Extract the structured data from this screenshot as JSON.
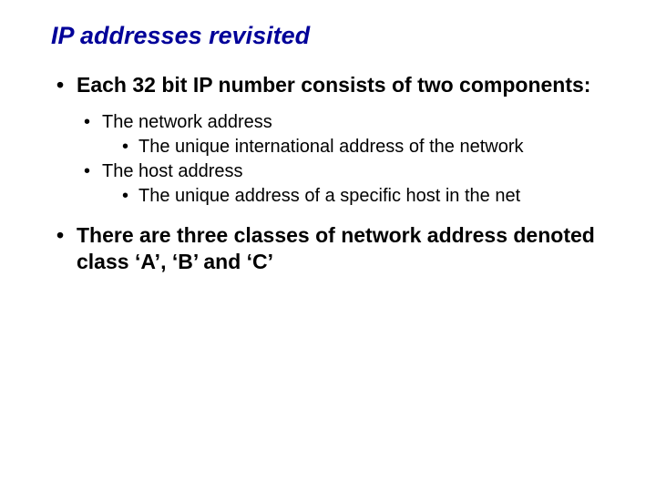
{
  "title": "IP addresses revisited",
  "bullets": {
    "b1": "Each 32 bit IP number consists of two components:",
    "b1a": "The network address",
    "b1a1": "The unique international address of the network",
    "b1b": "The host address",
    "b1b1": "The unique address of a specific host in the net",
    "b2": "There are three classes of network address denoted class ‘A’, ‘B’ and ‘C’"
  }
}
